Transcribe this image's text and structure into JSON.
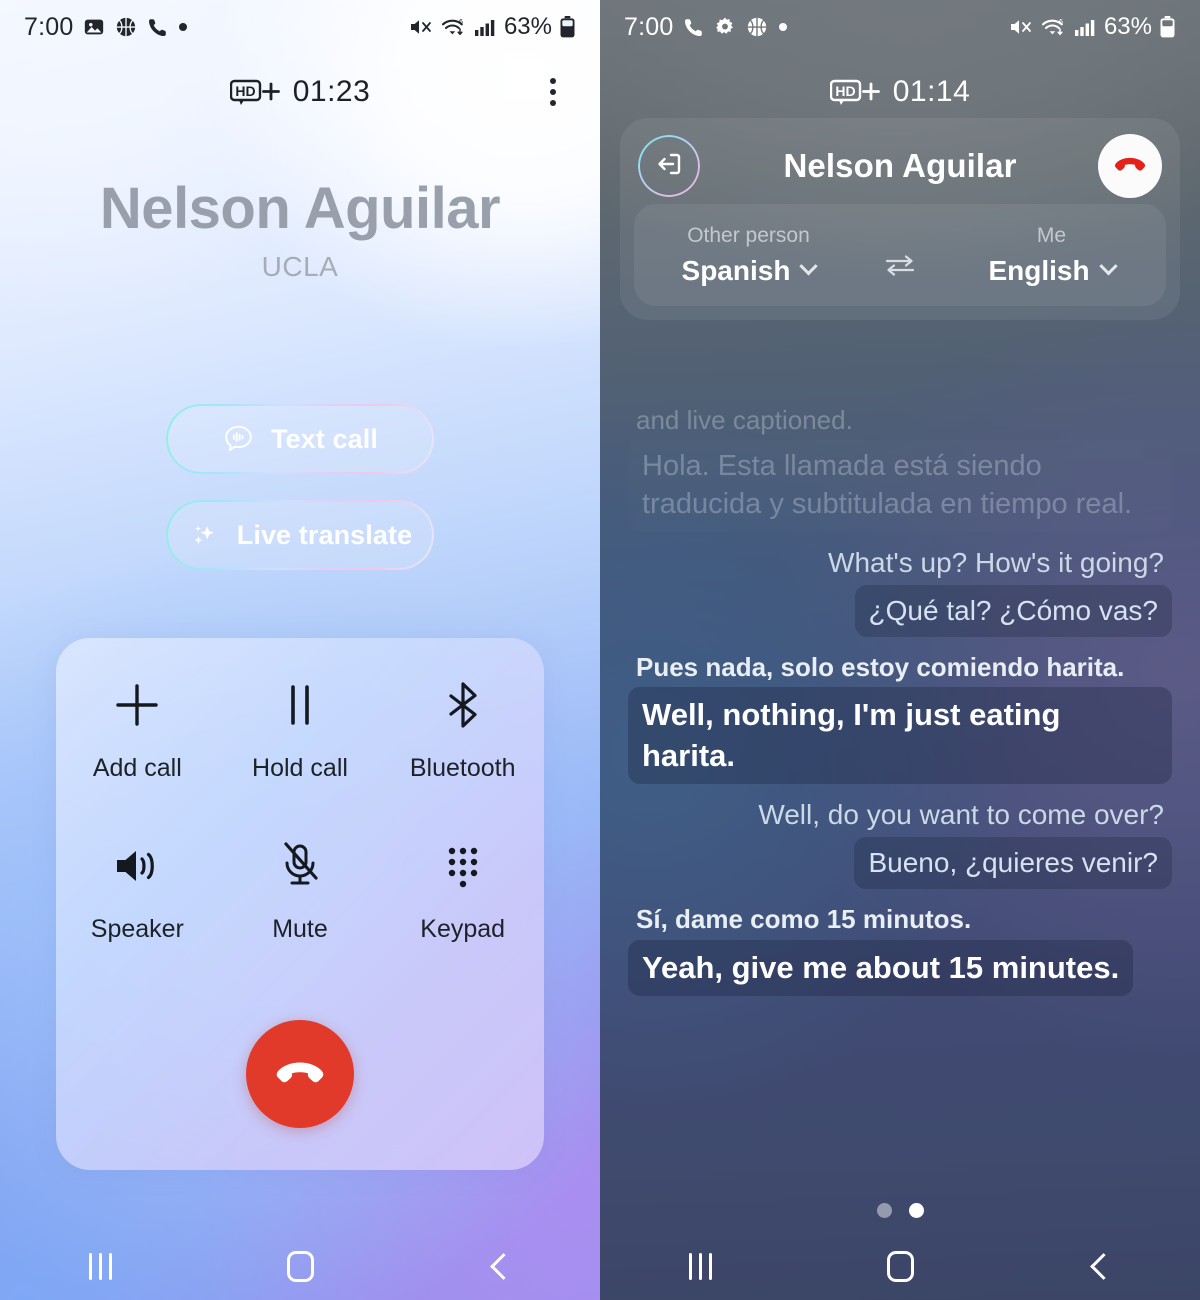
{
  "left_screen": {
    "status_bar": {
      "time": "7:00",
      "left_icons": [
        "image-icon",
        "basketball-icon",
        "phone-call-icon",
        "dot-icon"
      ],
      "right_icons": [
        "mute-volume-icon",
        "wifi-6-icon",
        "cellular-signal-icon"
      ],
      "battery_percent": "63%"
    },
    "call_header": {
      "hd_badge": "HD+",
      "duration": "01:23",
      "more_options": "more-options-icon"
    },
    "caller": {
      "name": "Nelson Aguilar",
      "subtitle": "UCLA"
    },
    "feature_buttons": [
      {
        "label": "Text call",
        "icon": "text-call-icon"
      },
      {
        "label": "Live translate",
        "icon": "sparkle-icon"
      }
    ],
    "controls": [
      {
        "label": "Add call",
        "icon": "plus-icon"
      },
      {
        "label": "Hold call",
        "icon": "pause-icon"
      },
      {
        "label": "Bluetooth",
        "icon": "bluetooth-icon"
      },
      {
        "label": "Speaker",
        "icon": "speaker-icon"
      },
      {
        "label": "Mute",
        "icon": "mic-muted-icon"
      },
      {
        "label": "Keypad",
        "icon": "keypad-icon"
      }
    ],
    "end_call": {
      "icon": "end-call-icon",
      "color": "#e1392a"
    },
    "nav_bar": [
      {
        "name": "recents-button",
        "icon": "recents-icon"
      },
      {
        "name": "home-button",
        "icon": "home-icon"
      },
      {
        "name": "back-button",
        "icon": "back-icon"
      }
    ]
  },
  "right_screen": {
    "status_bar": {
      "time": "7:00",
      "left_icons": [
        "phone-call-icon",
        "settings-gear-icon",
        "basketball-icon",
        "dot-icon"
      ],
      "right_icons": [
        "mute-volume-icon",
        "wifi-6-icon",
        "cellular-signal-icon"
      ],
      "battery_percent": "63%"
    },
    "call_header": {
      "hd_badge": "HD+",
      "duration": "01:14"
    },
    "translate_panel": {
      "exit_button": "exit-translate-icon",
      "title": "Nelson Aguilar",
      "hangup_button": "end-call-icon",
      "other_person_caption": "Other person",
      "other_person_language": "Spanish",
      "swap_button": "swap-languages-icon",
      "me_caption": "Me",
      "me_language": "English"
    },
    "transcript": [
      {
        "speaker": "them",
        "faded": true,
        "original": "and live captioned.",
        "translation": "Hola. Esta llamada está siendo traducida y subtitulada en tiempo real."
      },
      {
        "speaker": "me",
        "faded": false,
        "original": "What's up? How's it going?",
        "translation": "¿Qué tal? ¿Cómo vas?"
      },
      {
        "speaker": "them",
        "faded": false,
        "original": "Pues nada, solo estoy comiendo harita.",
        "translation": "Well, nothing, I'm just eating harita."
      },
      {
        "speaker": "me",
        "faded": false,
        "original": "Well, do you want to come over?",
        "translation": "Bueno, ¿quieres venir?"
      },
      {
        "speaker": "them",
        "faded": false,
        "original": "Sí, dame como 15 minutos.",
        "translation": "Yeah, give me about 15 minutes."
      }
    ],
    "page_dots": {
      "count": 2,
      "active_index": 1
    },
    "nav_bar": [
      {
        "name": "recents-button",
        "icon": "recents-icon"
      },
      {
        "name": "home-button",
        "icon": "home-icon"
      },
      {
        "name": "back-button",
        "icon": "back-icon"
      }
    ]
  }
}
